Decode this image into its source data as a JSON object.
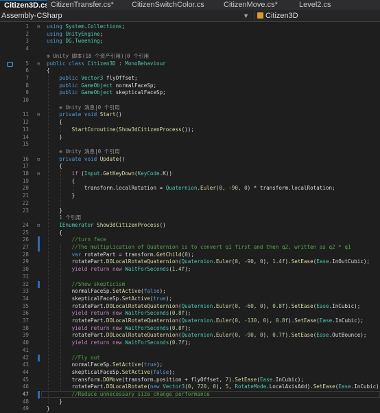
{
  "tabs": [
    {
      "label": "Citizen3D.cs*",
      "active": true,
      "close": "✕"
    },
    {
      "label": "CitizenTransfer.cs*"
    },
    {
      "label": "CitizenSwitchColor.cs"
    },
    {
      "label": "CitizenMove.cs*"
    },
    {
      "label": "Level2.cs"
    }
  ],
  "navbar": {
    "project": "Assembly-CSharp",
    "class": "Citizen3D"
  },
  "colors": {
    "keyword": "#569cd6",
    "control": "#c586c0",
    "type": "#4ec9b0",
    "method": "#dcdcaa",
    "number": "#b5cea8",
    "comment": "#57a64a",
    "change_bar": "#2f6bb1"
  },
  "lines": [
    {
      "n": "1",
      "fold": "⊟",
      "code": [
        [
          "k",
          "using "
        ],
        [
          "t",
          "System"
        ],
        [
          "",
          "."
        ],
        [
          "t",
          "Collections"
        ],
        [
          "",
          ";"
        ]
      ]
    },
    {
      "n": "2",
      "code": [
        [
          "k",
          "using "
        ],
        [
          "t",
          "UnityEngine"
        ],
        [
          "",
          ";"
        ]
      ]
    },
    {
      "n": "3",
      "code": [
        [
          "k",
          "using "
        ],
        [
          "t",
          "DG"
        ],
        [
          "",
          "."
        ],
        [
          "t",
          "Tweening"
        ],
        [
          "",
          ";"
        ]
      ]
    },
    {
      "n": "4",
      "code": []
    },
    {
      "n": "",
      "lens": true,
      "code": [
        [
          "lensicon",
          "⊕ "
        ],
        [
          "lens",
          "Unity 脚本(18 个资产引用)|0 个引用"
        ]
      ]
    },
    {
      "n": "5",
      "fold": "⊟",
      "icon": true,
      "code": [
        [
          "k",
          "public class "
        ],
        [
          "t",
          "Citizen3D"
        ],
        [
          "",
          " : "
        ],
        [
          "t",
          "MonoBehaviour"
        ]
      ]
    },
    {
      "n": "6",
      "code": [
        [
          "",
          "{"
        ]
      ]
    },
    {
      "n": "7",
      "code": [
        [
          "",
          "    "
        ],
        [
          "k",
          "public "
        ],
        [
          "t",
          "Vector3"
        ],
        [
          "",
          " flyOffset;"
        ]
      ]
    },
    {
      "n": "8",
      "code": [
        [
          "",
          "    "
        ],
        [
          "k",
          "public "
        ],
        [
          "t",
          "GameObject"
        ],
        [
          "",
          " normalFaceSp;"
        ]
      ]
    },
    {
      "n": "9",
      "code": [
        [
          "",
          "    "
        ],
        [
          "k",
          "public "
        ],
        [
          "t",
          "GameObject"
        ],
        [
          "",
          " skepticalFaceSp;"
        ]
      ]
    },
    {
      "n": "10",
      "code": []
    },
    {
      "n": "",
      "lens": true,
      "code": [
        [
          "",
          "    "
        ],
        [
          "lensicon",
          "⊕ "
        ],
        [
          "lens",
          "Unity 消息|0 个引用"
        ]
      ]
    },
    {
      "n": "11",
      "fold": "⊟",
      "code": [
        [
          "",
          "    "
        ],
        [
          "k",
          "private void "
        ],
        [
          "m",
          "Start"
        ],
        [
          "",
          "()"
        ]
      ]
    },
    {
      "n": "12",
      "code": [
        [
          "",
          "    {"
        ]
      ]
    },
    {
      "n": "13",
      "code": [
        [
          "",
          "        "
        ],
        [
          "m",
          "StartCoroutine"
        ],
        [
          "",
          "("
        ],
        [
          "m",
          "Show3dCitizenProcess"
        ],
        [
          "",
          "());"
        ]
      ]
    },
    {
      "n": "14",
      "code": [
        [
          "",
          "    }"
        ]
      ]
    },
    {
      "n": "15",
      "code": []
    },
    {
      "n": "",
      "lens": true,
      "code": [
        [
          "",
          "    "
        ],
        [
          "lensicon",
          "⊕ "
        ],
        [
          "lens",
          "Unity 消息|0 个引用"
        ]
      ]
    },
    {
      "n": "16",
      "fold": "⊟",
      "code": [
        [
          "",
          "    "
        ],
        [
          "k",
          "private void "
        ],
        [
          "m",
          "Update"
        ],
        [
          "",
          "()"
        ]
      ]
    },
    {
      "n": "17",
      "code": [
        [
          "",
          "    {"
        ]
      ]
    },
    {
      "n": "18",
      "fold": "⊟",
      "code": [
        [
          "",
          "        "
        ],
        [
          "c",
          "if "
        ],
        [
          "",
          "("
        ],
        [
          "t",
          "Input"
        ],
        [
          "",
          "."
        ],
        [
          "m",
          "GetKeyDown"
        ],
        [
          "",
          "("
        ],
        [
          "t",
          "KeyCode"
        ],
        [
          "",
          ".K))"
        ]
      ]
    },
    {
      "n": "19",
      "code": [
        [
          "",
          "        {"
        ]
      ]
    },
    {
      "n": "20",
      "code": [
        [
          "",
          "            transform.localRotation = "
        ],
        [
          "t",
          "Quaternion"
        ],
        [
          "",
          "."
        ],
        [
          "m",
          "Euler"
        ],
        [
          "",
          "("
        ],
        [
          "s",
          "0"
        ],
        [
          "",
          ", "
        ],
        [
          "s",
          "-90"
        ],
        [
          "",
          ", "
        ],
        [
          "s",
          "0"
        ],
        [
          "",
          ") * transform.localRotation;"
        ]
      ]
    },
    {
      "n": "21",
      "code": [
        [
          "",
          "        }"
        ]
      ]
    },
    {
      "n": "22",
      "code": []
    },
    {
      "n": "23",
      "code": [
        [
          "",
          "    }"
        ]
      ]
    },
    {
      "n": "",
      "lens": true,
      "code": [
        [
          "",
          "    "
        ],
        [
          "lens",
          "1 个引用"
        ]
      ]
    },
    {
      "n": "24",
      "fold": "⊟",
      "code": [
        [
          "",
          "    "
        ],
        [
          "t",
          "IEnumerator"
        ],
        [
          "",
          " "
        ],
        [
          "m",
          "Show3dCitizenProcess"
        ],
        [
          "",
          "()"
        ]
      ]
    },
    {
      "n": "25",
      "code": [
        [
          "",
          "    {"
        ]
      ]
    },
    {
      "n": "26",
      "bar": true,
      "code": [
        [
          "",
          "        "
        ],
        [
          "cm",
          "//turn face"
        ]
      ]
    },
    {
      "n": "27",
      "bar": true,
      "code": [
        [
          "",
          "        "
        ],
        [
          "cm",
          "//The multiplication of Quaternion is to convert q1 first and then q2, written as q2 * q1"
        ]
      ]
    },
    {
      "n": "28",
      "code": [
        [
          "",
          "        "
        ],
        [
          "k",
          "var "
        ],
        [
          "",
          "rotatePart = transform."
        ],
        [
          "m",
          "GetChild"
        ],
        [
          "",
          "("
        ],
        [
          "s",
          "0"
        ],
        [
          "",
          ");"
        ]
      ]
    },
    {
      "n": "29",
      "code": [
        [
          "",
          "        rotatePart."
        ],
        [
          "m",
          "DOLocalRotateQuaternion"
        ],
        [
          "",
          "("
        ],
        [
          "t",
          "Quaternion"
        ],
        [
          "",
          "."
        ],
        [
          "m",
          "Euler"
        ],
        [
          "",
          "("
        ],
        [
          "s",
          "0"
        ],
        [
          "",
          ", "
        ],
        [
          "s",
          "-90"
        ],
        [
          "",
          ", "
        ],
        [
          "s",
          "0"
        ],
        [
          "",
          "), "
        ],
        [
          "s",
          "1.4f"
        ],
        [
          "",
          ")."
        ],
        [
          "m",
          "SetEase"
        ],
        [
          "",
          "("
        ],
        [
          "t",
          "Ease"
        ],
        [
          "",
          ".InOutCubic);"
        ]
      ]
    },
    {
      "n": "30",
      "code": [
        [
          "",
          "        "
        ],
        [
          "c",
          "yield return new "
        ],
        [
          "t",
          "WaitForSeconds"
        ],
        [
          "",
          "("
        ],
        [
          "s",
          "1.4f"
        ],
        [
          "",
          ");"
        ]
      ]
    },
    {
      "n": "31",
      "code": []
    },
    {
      "n": "32",
      "bar": true,
      "code": [
        [
          "",
          "        "
        ],
        [
          "cm",
          "//Show skepticism"
        ]
      ]
    },
    {
      "n": "33",
      "code": [
        [
          "",
          "        normalFaceSp."
        ],
        [
          "m",
          "SetActive"
        ],
        [
          "",
          "("
        ],
        [
          "k",
          "false"
        ],
        [
          "",
          ");"
        ]
      ]
    },
    {
      "n": "34",
      "code": [
        [
          "",
          "        skepticalFaceSp."
        ],
        [
          "m",
          "SetActive"
        ],
        [
          "",
          "("
        ],
        [
          "k",
          "true"
        ],
        [
          "",
          ");"
        ]
      ]
    },
    {
      "n": "35",
      "code": [
        [
          "",
          "        rotatePart."
        ],
        [
          "m",
          "DOLocalRotateQuaternion"
        ],
        [
          "",
          "("
        ],
        [
          "t",
          "Quaternion"
        ],
        [
          "",
          "."
        ],
        [
          "m",
          "Euler"
        ],
        [
          "",
          "("
        ],
        [
          "s",
          "0"
        ],
        [
          "",
          ", "
        ],
        [
          "s",
          "-60"
        ],
        [
          "",
          ", "
        ],
        [
          "s",
          "0"
        ],
        [
          "",
          "), "
        ],
        [
          "s",
          "0.8f"
        ],
        [
          "",
          ")."
        ],
        [
          "m",
          "SetEase"
        ],
        [
          "",
          "("
        ],
        [
          "t",
          "Ease"
        ],
        [
          "",
          ".InCubic);"
        ]
      ]
    },
    {
      "n": "36",
      "code": [
        [
          "",
          "        "
        ],
        [
          "c",
          "yield return new "
        ],
        [
          "t",
          "WaitForSeconds"
        ],
        [
          "",
          "("
        ],
        [
          "s",
          "0.8f"
        ],
        [
          "",
          ");"
        ]
      ]
    },
    {
      "n": "37",
      "code": [
        [
          "",
          "        rotatePart."
        ],
        [
          "m",
          "DOLocalRotateQuaternion"
        ],
        [
          "",
          "("
        ],
        [
          "t",
          "Quaternion"
        ],
        [
          "",
          "."
        ],
        [
          "m",
          "Euler"
        ],
        [
          "",
          "("
        ],
        [
          "s",
          "0"
        ],
        [
          "",
          ", "
        ],
        [
          "s",
          "-130"
        ],
        [
          "",
          ", "
        ],
        [
          "s",
          "0"
        ],
        [
          "",
          "), "
        ],
        [
          "s",
          "0.8f"
        ],
        [
          "",
          ")."
        ],
        [
          "m",
          "SetEase"
        ],
        [
          "",
          "("
        ],
        [
          "t",
          "Ease"
        ],
        [
          "",
          ".InCubic);"
        ]
      ]
    },
    {
      "n": "38",
      "code": [
        [
          "",
          "        "
        ],
        [
          "c",
          "yield return new "
        ],
        [
          "t",
          "WaitForSeconds"
        ],
        [
          "",
          "("
        ],
        [
          "s",
          "0.8f"
        ],
        [
          "",
          ");"
        ]
      ]
    },
    {
      "n": "39",
      "code": [
        [
          "",
          "        rotatePart."
        ],
        [
          "m",
          "DOLocalRotateQuaternion"
        ],
        [
          "",
          "("
        ],
        [
          "t",
          "Quaternion"
        ],
        [
          "",
          "."
        ],
        [
          "m",
          "Euler"
        ],
        [
          "",
          "("
        ],
        [
          "s",
          "0"
        ],
        [
          "",
          ", "
        ],
        [
          "s",
          "-90"
        ],
        [
          "",
          ", "
        ],
        [
          "s",
          "0"
        ],
        [
          "",
          "), "
        ],
        [
          "s",
          "0.7f"
        ],
        [
          "",
          ")."
        ],
        [
          "m",
          "SetEase"
        ],
        [
          "",
          "("
        ],
        [
          "t",
          "Ease"
        ],
        [
          "",
          ".OutBounce);"
        ]
      ]
    },
    {
      "n": "40",
      "code": [
        [
          "",
          "        "
        ],
        [
          "c",
          "yield return new "
        ],
        [
          "t",
          "WaitForSeconds"
        ],
        [
          "",
          "("
        ],
        [
          "s",
          "0.7f"
        ],
        [
          "",
          ");"
        ]
      ]
    },
    {
      "n": "41",
      "code": []
    },
    {
      "n": "42",
      "bar": true,
      "code": [
        [
          "",
          "        "
        ],
        [
          "cm",
          "//Fly out"
        ]
      ]
    },
    {
      "n": "43",
      "code": [
        [
          "",
          "        normalFaceSp."
        ],
        [
          "m",
          "SetActive"
        ],
        [
          "",
          "("
        ],
        [
          "k",
          "true"
        ],
        [
          "",
          ");"
        ]
      ]
    },
    {
      "n": "44",
      "code": [
        [
          "",
          "        skepticalFaceSp."
        ],
        [
          "m",
          "SetActive"
        ],
        [
          "",
          "("
        ],
        [
          "k",
          "false"
        ],
        [
          "",
          ");"
        ]
      ]
    },
    {
      "n": "45",
      "code": [
        [
          "",
          "        transform."
        ],
        [
          "m",
          "DOMove"
        ],
        [
          "",
          "(transform.position + flyOffset, "
        ],
        [
          "s",
          "7"
        ],
        [
          "",
          ")."
        ],
        [
          "m",
          "SetEase"
        ],
        [
          "",
          "("
        ],
        [
          "t",
          "Ease"
        ],
        [
          "",
          ".InCubic);"
        ]
      ]
    },
    {
      "n": "46",
      "code": [
        [
          "",
          "        rotatePart."
        ],
        [
          "m",
          "DOLocalRotate"
        ],
        [
          "",
          "("
        ],
        [
          "k",
          "new "
        ],
        [
          "t",
          "Vector3"
        ],
        [
          "",
          "("
        ],
        [
          "s",
          "0"
        ],
        [
          "",
          ", "
        ],
        [
          "s",
          "720"
        ],
        [
          "",
          ", "
        ],
        [
          "s",
          "0"
        ],
        [
          "",
          "), "
        ],
        [
          "s",
          "5"
        ],
        [
          "",
          ", "
        ],
        [
          "t",
          "RotateMode"
        ],
        [
          "",
          ".LocalAxisAdd)."
        ],
        [
          "m",
          "SetEase"
        ],
        [
          "",
          "("
        ],
        [
          "t",
          "Ease"
        ],
        [
          "",
          ".InCubic);"
        ]
      ]
    },
    {
      "n": "47",
      "bar": true,
      "current": true,
      "code": [
        [
          "",
          "        "
        ],
        [
          "cm",
          "//Reduce unnecessary size change performance"
        ]
      ]
    },
    {
      "n": "48",
      "code": [
        [
          "",
          "    }"
        ]
      ]
    },
    {
      "n": "49",
      "code": [
        [
          "",
          "}"
        ]
      ]
    }
  ]
}
